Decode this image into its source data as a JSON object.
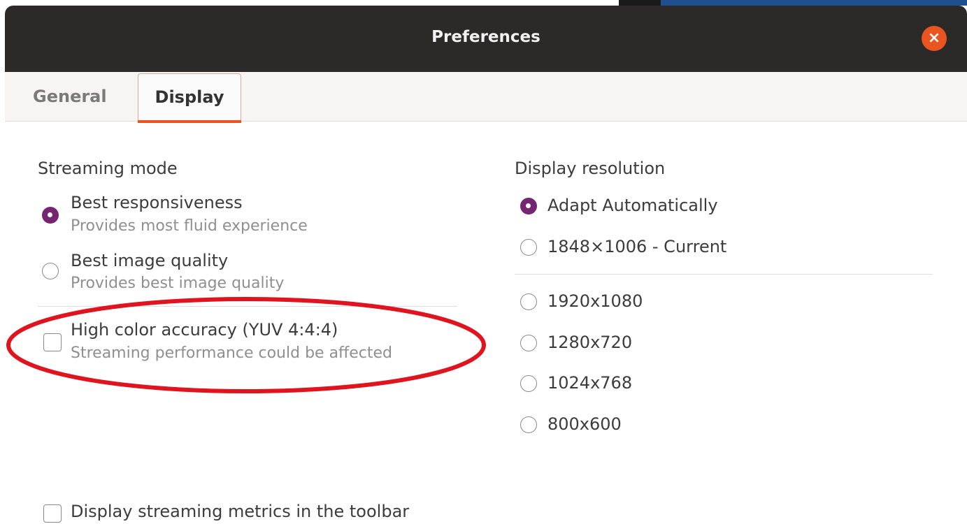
{
  "window": {
    "title": "Preferences",
    "close_symbol": "×"
  },
  "tabs": [
    {
      "label": "General",
      "active": false
    },
    {
      "label": "Display",
      "active": true
    }
  ],
  "streaming_mode": {
    "label": "Streaming mode",
    "options": [
      {
        "label": "Best responsiveness",
        "description": "Provides most fluid experience",
        "selected": true
      },
      {
        "label": "Best image quality",
        "description": "Provides best image quality",
        "selected": false
      }
    ],
    "high_color": {
      "label": "High color accuracy (YUV 4:4:4)",
      "description": "Streaming performance could be affected",
      "checked": false
    }
  },
  "display_resolution": {
    "label": "Display resolution",
    "options": [
      {
        "label": "Adapt Automatically",
        "selected": true
      },
      {
        "label": "1848×1006 - Current",
        "selected": false
      },
      {
        "label": "1920x1080",
        "selected": false
      },
      {
        "label": "1280x720",
        "selected": false
      },
      {
        "label": "1024x768",
        "selected": false
      },
      {
        "label": "800x600",
        "selected": false
      }
    ]
  },
  "metrics": {
    "label": "Display streaming metrics in the toolbar",
    "checked": false
  },
  "colors": {
    "accent": "#e95420",
    "radio_selected": "#762572",
    "titlebar": "#2c2a28",
    "annotation": "#e0141e"
  }
}
